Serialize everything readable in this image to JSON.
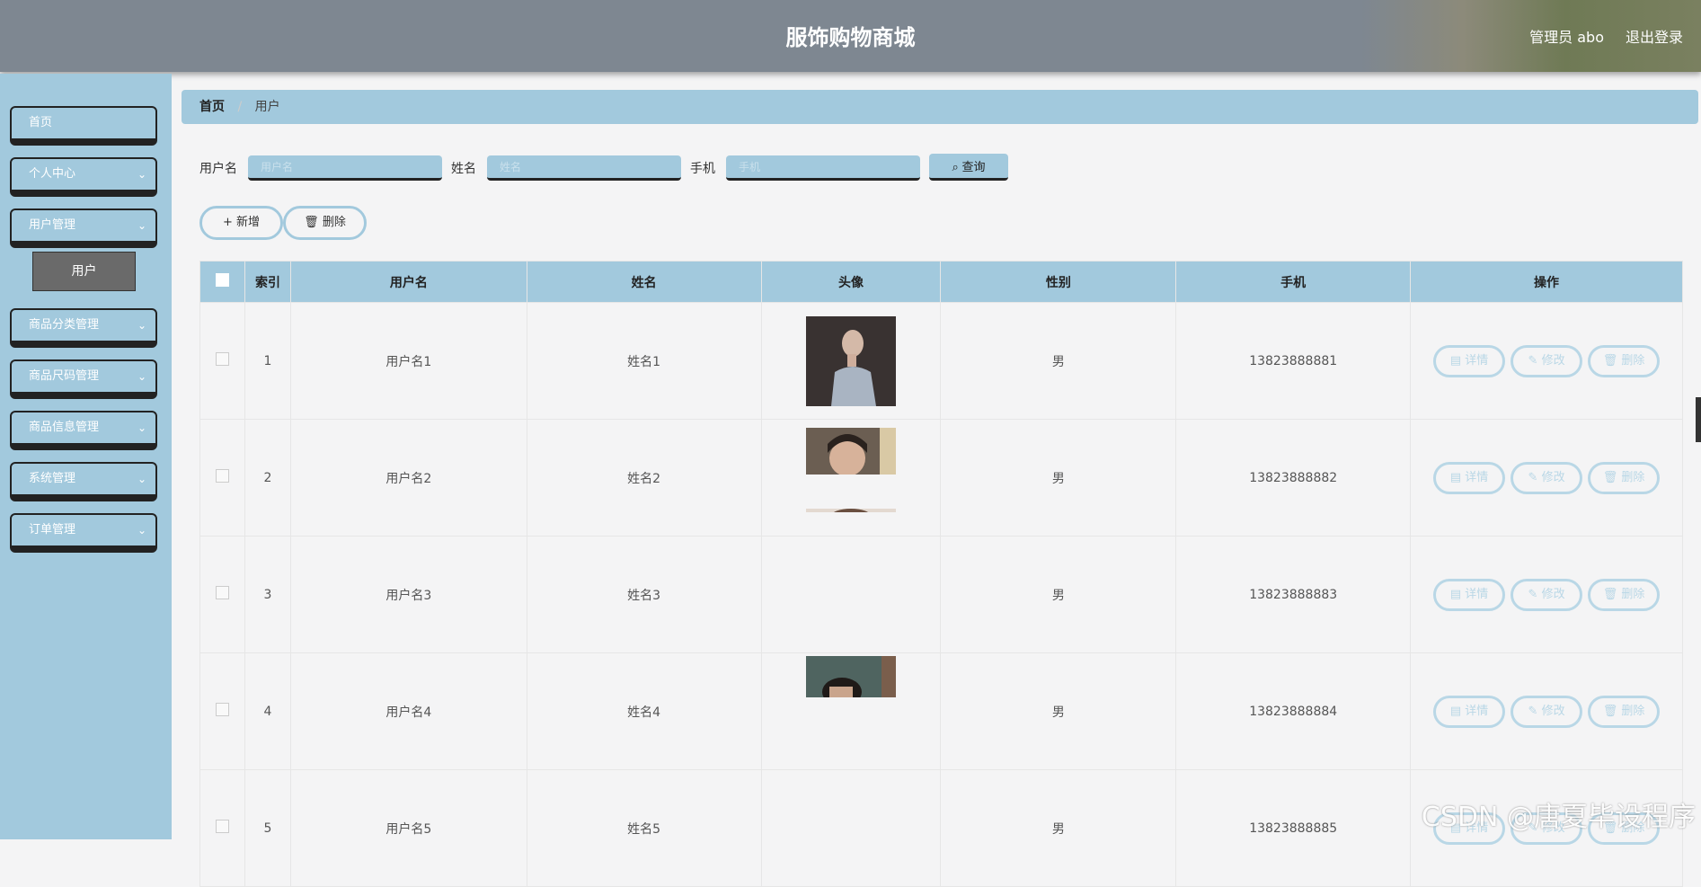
{
  "header": {
    "title": "服饰购物商城",
    "user": "管理员 abo",
    "logout": "退出登录"
  },
  "sidebar": {
    "items": [
      {
        "label": "首页",
        "has_children": false
      },
      {
        "label": "个人中心",
        "has_children": true
      },
      {
        "label": "用户管理",
        "has_children": true
      },
      {
        "label": "商品分类管理",
        "has_children": true
      },
      {
        "label": "商品尺码管理",
        "has_children": true
      },
      {
        "label": "商品信息管理",
        "has_children": true
      },
      {
        "label": "系统管理",
        "has_children": true
      },
      {
        "label": "订单管理",
        "has_children": true
      }
    ],
    "active_sub": "用户",
    "chevron": "chevron-down-icon"
  },
  "breadcrumb": {
    "home": "首页",
    "separator": "/",
    "current": "用户"
  },
  "search": {
    "username_label": "用户名",
    "username_placeholder": "用户名",
    "name_label": "姓名",
    "name_placeholder": "姓名",
    "phone_label": "手机",
    "phone_placeholder": "手机",
    "button": "查询"
  },
  "actions": {
    "add": "新增",
    "delete": "删除"
  },
  "table": {
    "headers": [
      "索引",
      "用户名",
      "姓名",
      "头像",
      "性别",
      "手机",
      "操作"
    ],
    "rows": [
      {
        "index": "1",
        "username": "用户名1",
        "name": "姓名1",
        "gender": "男",
        "phone": "13823888881"
      },
      {
        "index": "2",
        "username": "用户名2",
        "name": "姓名2",
        "gender": "男",
        "phone": "13823888882"
      },
      {
        "index": "3",
        "username": "用户名3",
        "name": "姓名3",
        "gender": "男",
        "phone": "13823888883"
      },
      {
        "index": "4",
        "username": "用户名4",
        "name": "姓名4",
        "gender": "男",
        "phone": "13823888884"
      },
      {
        "index": "5",
        "username": "用户名5",
        "name": "姓名5",
        "gender": "男",
        "phone": "13823888885"
      }
    ],
    "row_actions": {
      "detail": "详情",
      "edit": "修改",
      "delete": "删除"
    }
  },
  "watermark": "CSDN @唐夏毕设程序",
  "colors": {
    "accent": "#a2c9dd",
    "header": "#7e8791",
    "background": "#f4f4f5"
  }
}
